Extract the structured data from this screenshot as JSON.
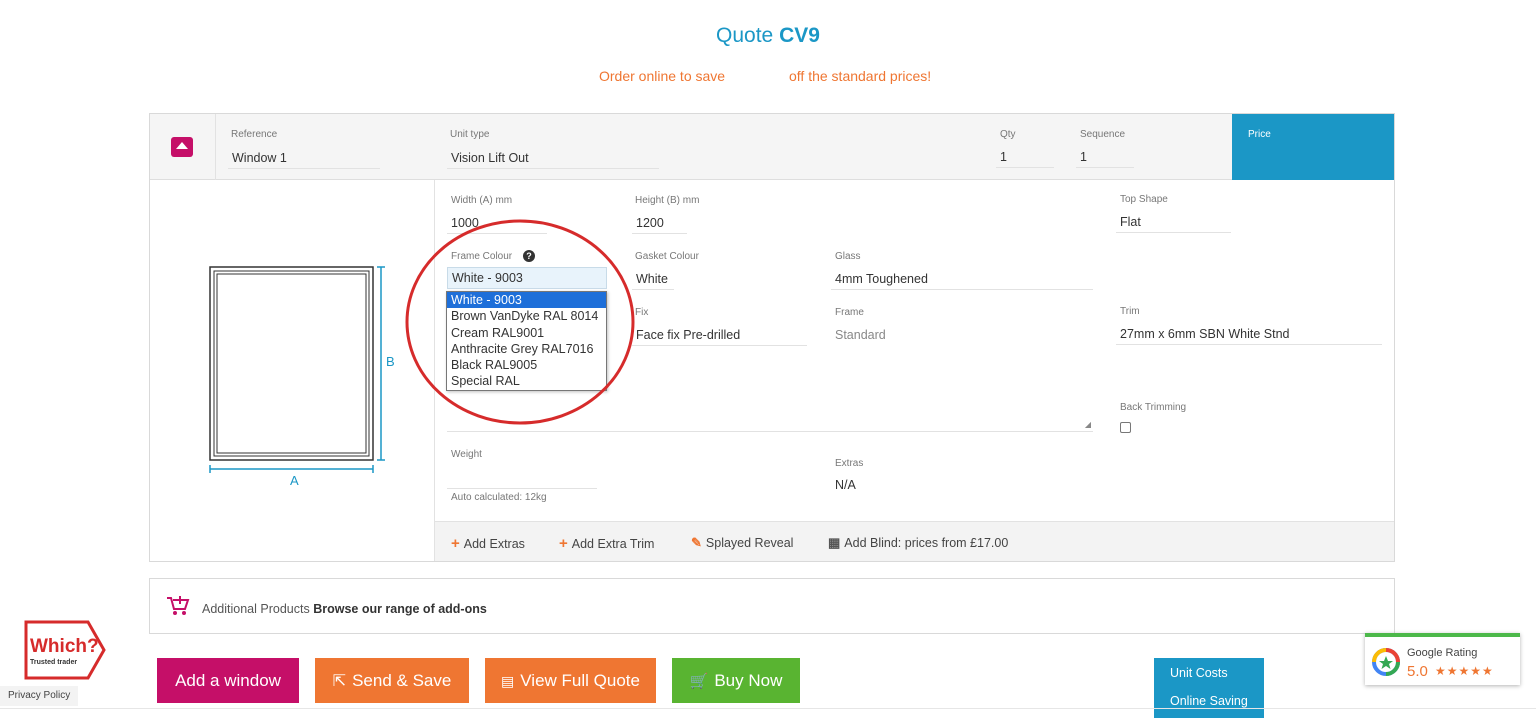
{
  "header": {
    "quote_label": "Quote",
    "quote_code": "CV9",
    "promo_left": "Order online to save",
    "promo_right": "off the standard prices!"
  },
  "window_row": {
    "reference_label": "Reference",
    "reference_value": "Window 1",
    "unit_type_label": "Unit type",
    "unit_type_value": "Vision Lift Out",
    "qty_label": "Qty",
    "qty_value": "1",
    "sequence_label": "Sequence",
    "sequence_value": "1",
    "price_label": "Price"
  },
  "diagram": {
    "label_a": "A",
    "label_b": "B"
  },
  "fields": {
    "width_label": "Width (A) mm",
    "width_value": "1000",
    "height_label": "Height (B) mm",
    "height_value": "1200",
    "top_shape_label": "Top Shape",
    "top_shape_value": "Flat",
    "frame_colour_label": "Frame Colour",
    "frame_colour_value": "White - 9003",
    "gasket_label": "Gasket Colour",
    "gasket_value": "White",
    "glass_label": "Glass",
    "glass_value": "4mm Toughened",
    "fix_label": "Fix",
    "fix_value": "Face fix Pre-drilled",
    "frame_label": "Frame",
    "frame_value": "Standard",
    "trim_label": "Trim",
    "trim_value": "27mm x 6mm SBN White Stnd",
    "back_trimming_label": "Back Trimming",
    "weight_label": "Weight",
    "weight_note": "Auto calculated: 12kg",
    "extras_label": "Extras",
    "extras_value": "N/A"
  },
  "frame_colour_options": [
    "White - 9003",
    "Brown VanDyke RAL 8014",
    "Cream RAL9001",
    "Anthracite Grey RAL7016",
    "Black RAL9005",
    "Special RAL"
  ],
  "actions": {
    "add_extras": "Add Extras",
    "add_extra_trim": "Add Extra Trim",
    "splayed_reveal": "Splayed Reveal",
    "add_blind": "Add Blind: prices from £17.00"
  },
  "additional": {
    "label": "Additional Products",
    "link": "Browse our range of add-ons"
  },
  "buttons": {
    "add_window": "Add a window",
    "send_save": "Send & Save",
    "view_quote": "View Full Quote",
    "buy_now": "Buy Now"
  },
  "summary": {
    "unit_costs": "Unit Costs",
    "online_saving": "Online Saving"
  },
  "badges": {
    "which_title": "Which?",
    "which_sub": "Trusted trader",
    "privacy": "Privacy Policy",
    "google_label": "Google Rating",
    "google_score": "5.0",
    "google_stars": "★★★★★"
  },
  "colors": {
    "brand_blue": "#1b97c6",
    "brand_pink": "#c50f68",
    "brand_orange": "#ef7632",
    "brand_green": "#59b431",
    "annotation_red": "#d62b2b"
  }
}
